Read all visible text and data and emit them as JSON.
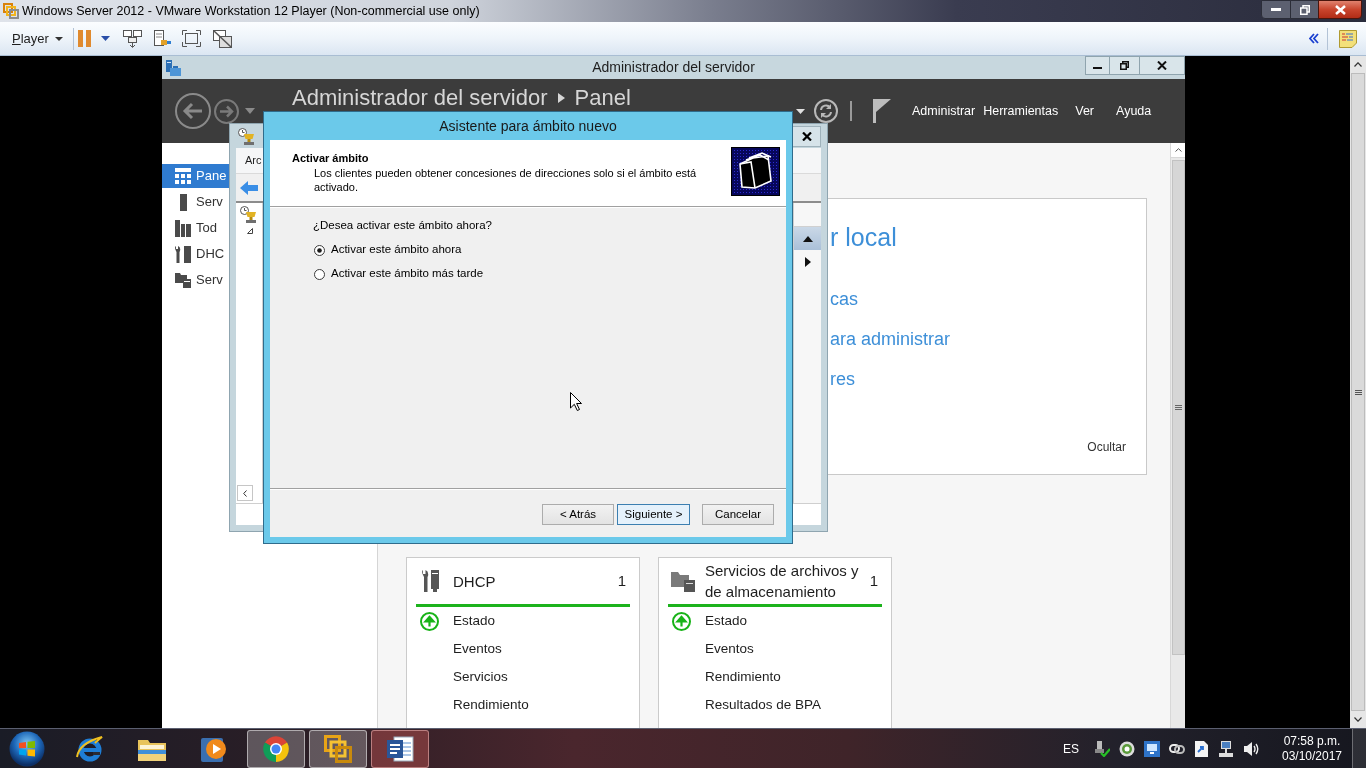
{
  "vm_player": {
    "title": "Windows Server 2012 - VMware Workstation 12 Player (Non-commercial use only)",
    "menu": "Player"
  },
  "server_manager": {
    "title": "Administrador del servidor",
    "breadcrumb": [
      "Administrador del servidor",
      "Panel"
    ],
    "menu": [
      "Administrar",
      "Herramientas",
      "Ver",
      "Ayuda"
    ],
    "sidebar": [
      {
        "label": "Pane",
        "selected": true
      },
      {
        "label": "Serv",
        "selected": false
      },
      {
        "label": "Tod",
        "selected": false
      },
      {
        "label": "DHC",
        "selected": false
      },
      {
        "label": "Serv",
        "selected": false
      }
    ],
    "welcome": {
      "heading": "r local",
      "links": [
        "cas",
        "ara administrar",
        "res"
      ],
      "hide": "Ocultar"
    },
    "tiles": [
      {
        "title": "DHCP",
        "count": "1",
        "rows": [
          {
            "label": "Estado",
            "ok": true
          },
          {
            "label": "Eventos",
            "ok": false
          },
          {
            "label": "Servicios",
            "ok": false
          },
          {
            "label": "Rendimiento",
            "ok": false
          }
        ]
      },
      {
        "title": "Servicios de archivos y de almacenamiento",
        "count": "1",
        "rows": [
          {
            "label": "Estado",
            "ok": true
          },
          {
            "label": "Eventos",
            "ok": false
          },
          {
            "label": "Rendimiento",
            "ok": false
          },
          {
            "label": "Resultados de BPA",
            "ok": false
          }
        ]
      }
    ]
  },
  "dhcp_console": {
    "menu": [
      "Arc"
    ]
  },
  "wizard": {
    "title": "Asistente para ámbito nuevo",
    "heading": "Activar ámbito",
    "description": "Los clientes pueden obtener concesiones de direcciones solo si el ámbito está activado.",
    "question": "¿Desea activar este ámbito ahora?",
    "options": [
      {
        "label": "Activar este ámbito ahora",
        "selected": true
      },
      {
        "label": "Activar este ámbito más tarde",
        "selected": false
      }
    ],
    "buttons": [
      {
        "label": "< Atrás",
        "default": false
      },
      {
        "label": "Siguiente >",
        "default": true
      },
      {
        "label": "Cancelar",
        "default": false
      }
    ]
  },
  "taskbar": {
    "apps": [
      {
        "running": false
      },
      {
        "running": false
      },
      {
        "running": false
      },
      {
        "running": true
      },
      {
        "running": true
      },
      {
        "running": true
      }
    ],
    "language": "ES",
    "time": "07:58 p.m.",
    "date": "03/10/2017"
  }
}
